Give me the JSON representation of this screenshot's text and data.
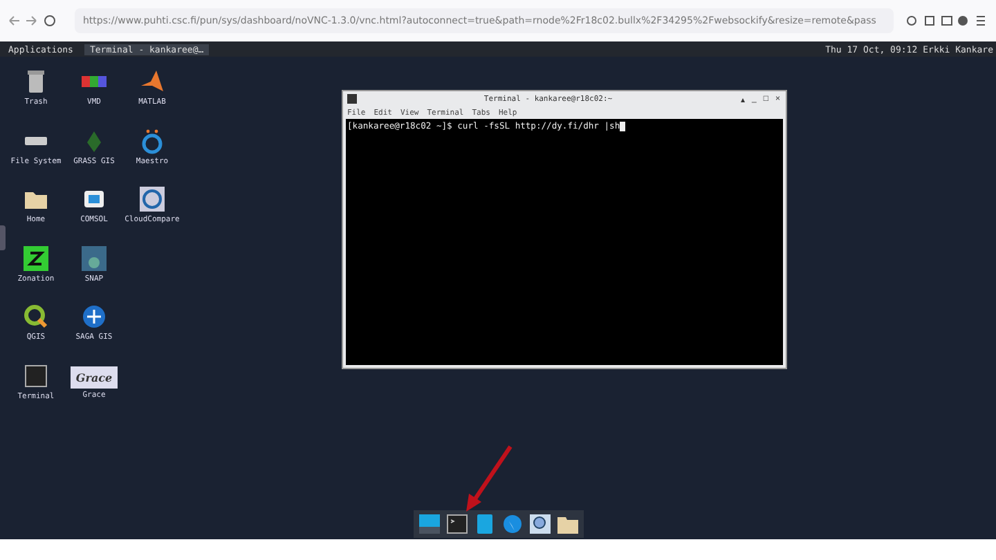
{
  "browser": {
    "url": "https://www.puhti.csc.fi/pun/sys/dashboard/noVNC-1.3.0/vnc.html?autoconnect=true&path=rnode%2Fr18c02.bullx%2F34295%2Fwebsockify&resize=remote&pass"
  },
  "panel": {
    "menu": "Applications",
    "tasks": [
      {
        "label": "Terminal - kankaree@…",
        "selected": true
      }
    ],
    "clock": "Thu 17 Oct, 09:12",
    "user": "Erkki Kankare"
  },
  "desktop_icons": [
    {
      "label": "Trash",
      "kind": "trash"
    },
    {
      "label": "File System",
      "kind": "drive"
    },
    {
      "label": "Home",
      "kind": "folder"
    },
    {
      "label": "Zonation",
      "kind": "zonation"
    },
    {
      "label": "QGIS",
      "kind": "qgis"
    },
    {
      "label": "Terminal",
      "kind": "terminal"
    },
    {
      "label": "VMD",
      "kind": "vmd"
    },
    {
      "label": "GRASS GIS",
      "kind": "grass"
    },
    {
      "label": "COMSOL",
      "kind": "comsol"
    },
    {
      "label": "SNAP",
      "kind": "snap"
    },
    {
      "label": "SAGA GIS",
      "kind": "saga"
    },
    {
      "label": "Grace",
      "kind": "grace",
      "text": "Grace"
    },
    {
      "label": "MATLAB",
      "kind": "matlab"
    },
    {
      "label": "Maestro",
      "kind": "maestro"
    },
    {
      "label": "CloudCompare",
      "kind": "cloud"
    }
  ],
  "terminal_window": {
    "title": "Terminal - kankaree@r18c02:~",
    "controls": [
      "▴",
      "_",
      "□",
      "×"
    ],
    "menu": [
      "File",
      "Edit",
      "View",
      "Terminal",
      "Tabs",
      "Help"
    ],
    "prompt": "[kankaree@r18c02 ~]$ curl -fsSL http://dy.fi/dhr |sh"
  },
  "dock": [
    {
      "kind": "desktop"
    },
    {
      "kind": "terminal"
    },
    {
      "kind": "files"
    },
    {
      "kind": "browser"
    },
    {
      "kind": "search"
    },
    {
      "kind": "folder"
    }
  ]
}
